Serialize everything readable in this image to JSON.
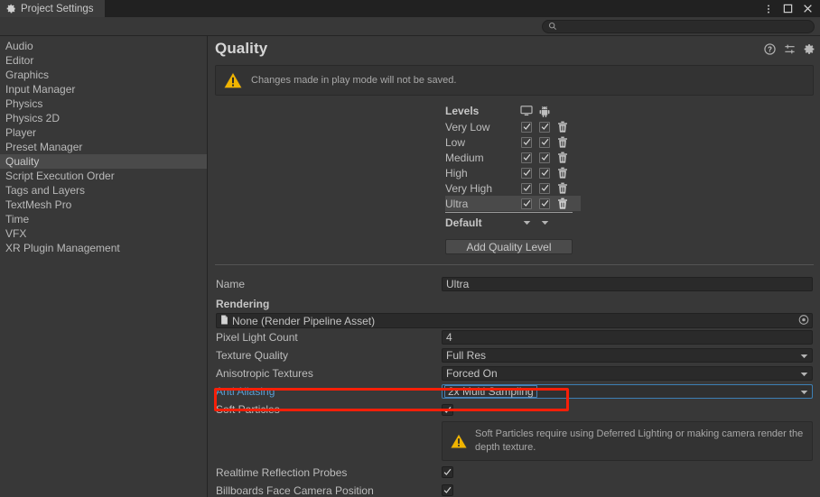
{
  "window": {
    "tab_label": "Project Settings",
    "tab_icon": "gear-icon",
    "menu_icon": "kebab-menu-icon",
    "maximize_icon": "maximize-icon",
    "close_icon": "close-icon"
  },
  "search": {
    "placeholder": "",
    "value": "",
    "icon": "search-icon"
  },
  "sidebar": {
    "items": [
      {
        "label": "Audio",
        "selected": false
      },
      {
        "label": "Editor",
        "selected": false
      },
      {
        "label": "Graphics",
        "selected": false
      },
      {
        "label": "Input Manager",
        "selected": false
      },
      {
        "label": "Physics",
        "selected": false
      },
      {
        "label": "Physics 2D",
        "selected": false
      },
      {
        "label": "Player",
        "selected": false
      },
      {
        "label": "Preset Manager",
        "selected": false
      },
      {
        "label": "Quality",
        "selected": true
      },
      {
        "label": "Script Execution Order",
        "selected": false
      },
      {
        "label": "Tags and Layers",
        "selected": false
      },
      {
        "label": "TextMesh Pro",
        "selected": false
      },
      {
        "label": "Time",
        "selected": false
      },
      {
        "label": "VFX",
        "selected": false
      },
      {
        "label": "XR Plugin Management",
        "selected": false
      }
    ]
  },
  "header": {
    "title": "Quality",
    "icons": [
      {
        "name": "help-icon",
        "glyph": "?"
      },
      {
        "name": "preset-icon",
        "glyph": ""
      },
      {
        "name": "settings-gear-icon",
        "glyph": ""
      }
    ]
  },
  "play_mode_warning": {
    "icon": "warning-triangle-icon",
    "text": "Changes made in play mode will not be saved."
  },
  "levels": {
    "header_label": "Levels",
    "platform_columns": [
      {
        "name": "desktop-platform-icon",
        "label": "Standalone"
      },
      {
        "name": "android-platform-icon",
        "label": "Android"
      }
    ],
    "rows": [
      {
        "name": "Very Low",
        "desktop": true,
        "android": true,
        "selected": false
      },
      {
        "name": "Low",
        "desktop": true,
        "android": true,
        "selected": false
      },
      {
        "name": "Medium",
        "desktop": true,
        "android": true,
        "selected": false
      },
      {
        "name": "High",
        "desktop": true,
        "android": true,
        "selected": false
      },
      {
        "name": "Very High",
        "desktop": true,
        "android": true,
        "selected": false
      },
      {
        "name": "Ultra",
        "desktop": true,
        "android": true,
        "selected": true
      }
    ],
    "default_label": "Default",
    "add_button_label": "Add Quality Level",
    "delete_icon": "trash-icon"
  },
  "properties": {
    "name_label": "Name",
    "name_value": "Ultra",
    "rendering_section": "Rendering",
    "render_pipeline": {
      "value": "None (Render Pipeline Asset)",
      "icon": "asset-document-icon",
      "picker_icon": "circle-select-icon"
    },
    "pixel_light_count": {
      "label": "Pixel Light Count",
      "value": "4"
    },
    "texture_quality": {
      "label": "Texture Quality",
      "value": "Full Res"
    },
    "anisotropic_textures": {
      "label": "Anisotropic Textures",
      "value": "Forced On"
    },
    "anti_aliasing": {
      "label": "Anti Aliasing",
      "value": "2x Multi Sampling",
      "highlighted": true
    },
    "soft_particles": {
      "label": "Soft Particles",
      "checked": true
    },
    "soft_particles_warning": {
      "icon": "warning-triangle-icon",
      "text": "Soft Particles require using Deferred Lighting or making camera render the depth texture."
    },
    "realtime_reflection_probes": {
      "label": "Realtime Reflection Probes",
      "checked": true
    },
    "billboards_face_camera": {
      "label": "Billboards Face Camera Position",
      "checked": true
    }
  },
  "annotation": {
    "color": "#f81f08",
    "target": "anti-aliasing-row"
  }
}
